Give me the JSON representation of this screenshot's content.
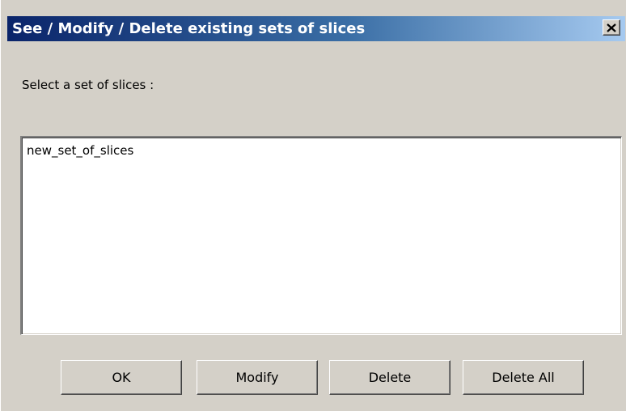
{
  "window": {
    "title": "See / Modify / Delete existing sets of slices"
  },
  "prompt": {
    "label": "Select a set of slices :"
  },
  "list": {
    "items": [
      "new_set_of_slices"
    ]
  },
  "buttons": {
    "ok_label": "OK",
    "modify_label": "Modify",
    "delete_label": "Delete",
    "delete_all_label": "Delete All"
  },
  "colors": {
    "dialog_background": "#d4d0c8",
    "titlebar_start": "#0a246a",
    "titlebar_end": "#a6caf0",
    "title_text": "#ffffff",
    "list_background": "#ffffff"
  },
  "icons": {
    "close": "close-icon"
  }
}
